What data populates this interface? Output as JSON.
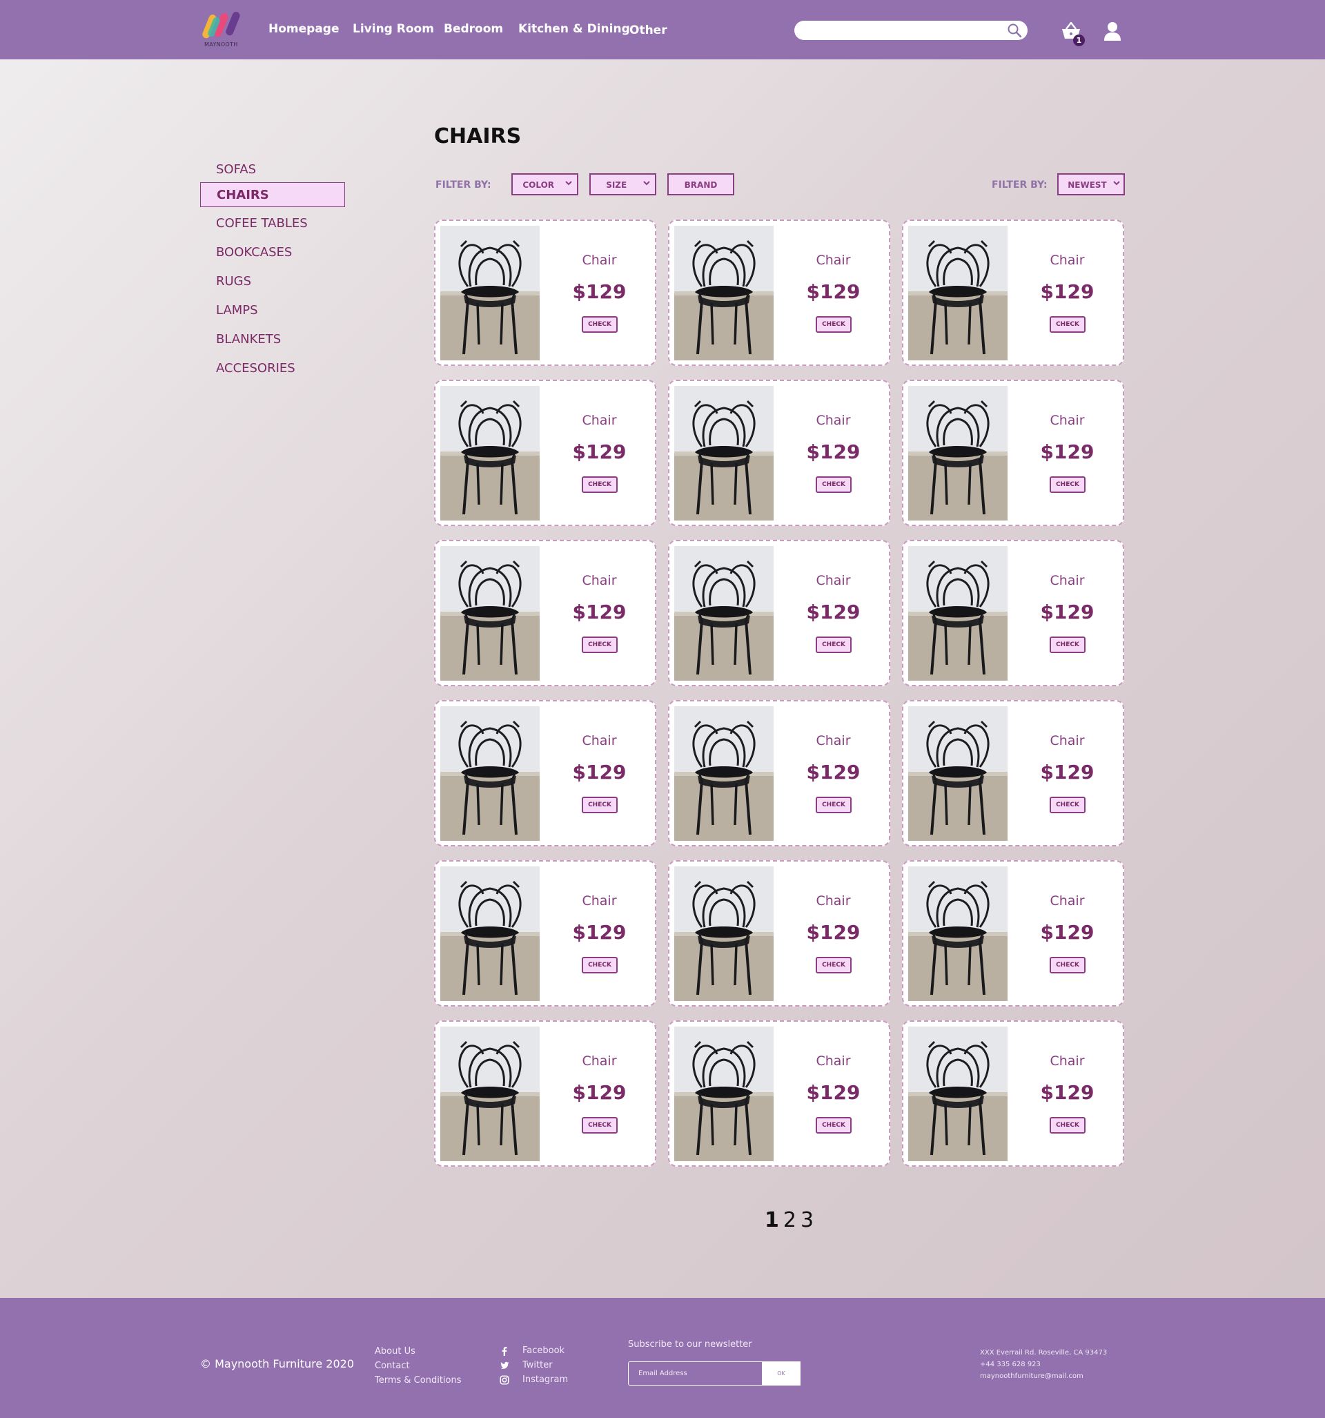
{
  "header": {
    "logo_text": "MAYNOOTH",
    "nav": [
      {
        "label": "Homepage"
      },
      {
        "label": "Living Room"
      },
      {
        "label": "Bedroom"
      },
      {
        "label": "Kitchen & Dining"
      },
      {
        "label": "Other"
      }
    ],
    "search": {
      "placeholder": "",
      "icon": "search-icon"
    },
    "cart": {
      "count": "1",
      "icon": "basket-icon"
    },
    "user_icon": "user-icon"
  },
  "sidebar": {
    "items": [
      {
        "label": "SOFAS",
        "active": false
      },
      {
        "label": "CHAIRS",
        "active": true
      },
      {
        "label": "COFEE TABLES",
        "active": false
      },
      {
        "label": "BOOKCASES",
        "active": false
      },
      {
        "label": "RUGS",
        "active": false
      },
      {
        "label": "LAMPS",
        "active": false
      },
      {
        "label": "BLANKETS",
        "active": false
      },
      {
        "label": "ACCESORIES",
        "active": false
      }
    ]
  },
  "main": {
    "title": "CHAIRS",
    "filter_left_label": "FILTER BY:",
    "filters": [
      {
        "label": "COLOR"
      },
      {
        "label": "SIZE"
      },
      {
        "label": "BRAND"
      }
    ],
    "filter_right_label": "FILTER BY:",
    "sort": {
      "label": "NEWEST"
    },
    "products": [
      {
        "name": "Chair",
        "price": "$129",
        "action": "CHECK"
      },
      {
        "name": "Chair",
        "price": "$129",
        "action": "CHECK"
      },
      {
        "name": "Chair",
        "price": "$129",
        "action": "CHECK"
      },
      {
        "name": "Chair",
        "price": "$129",
        "action": "CHECK"
      },
      {
        "name": "Chair",
        "price": "$129",
        "action": "CHECK"
      },
      {
        "name": "Chair",
        "price": "$129",
        "action": "CHECK"
      },
      {
        "name": "Chair",
        "price": "$129",
        "action": "CHECK"
      },
      {
        "name": "Chair",
        "price": "$129",
        "action": "CHECK"
      },
      {
        "name": "Chair",
        "price": "$129",
        "action": "CHECK"
      },
      {
        "name": "Chair",
        "price": "$129",
        "action": "CHECK"
      },
      {
        "name": "Chair",
        "price": "$129",
        "action": "CHECK"
      },
      {
        "name": "Chair",
        "price": "$129",
        "action": "CHECK"
      },
      {
        "name": "Chair",
        "price": "$129",
        "action": "CHECK"
      },
      {
        "name": "Chair",
        "price": "$129",
        "action": "CHECK"
      },
      {
        "name": "Chair",
        "price": "$129",
        "action": "CHECK"
      },
      {
        "name": "Chair",
        "price": "$129",
        "action": "CHECK"
      },
      {
        "name": "Chair",
        "price": "$129",
        "action": "CHECK"
      },
      {
        "name": "Chair",
        "price": "$129",
        "action": "CHECK"
      }
    ],
    "pagination": [
      {
        "label": "1",
        "current": true
      },
      {
        "label": "2",
        "current": false
      },
      {
        "label": "3",
        "current": false
      }
    ]
  },
  "footer": {
    "copyright": "© Maynooth Furniture 2020",
    "links": [
      {
        "label": "About Us"
      },
      {
        "label": "Contact"
      },
      {
        "label": "Terms & Conditions"
      }
    ],
    "social": [
      {
        "label": "Facebook",
        "icon": "facebook-icon"
      },
      {
        "label": "Twitter",
        "icon": "twitter-icon"
      },
      {
        "label": "Instagram",
        "icon": "instagram-icon"
      }
    ],
    "newsletter": {
      "label": "Subscribe to our newsletter",
      "placeholder": "Email Address",
      "button": "OK"
    },
    "contact": {
      "address": "XXX Everrail Rd. Roseville, CA 93473",
      "phone": "+44 335 628 923",
      "email": "maynoothfurniture@mail.com"
    }
  },
  "colors": {
    "header_bg": "#9271ae",
    "accent": "#7a2a66",
    "active_bg": "#f6d9f7",
    "badge": "#4b1f62"
  }
}
